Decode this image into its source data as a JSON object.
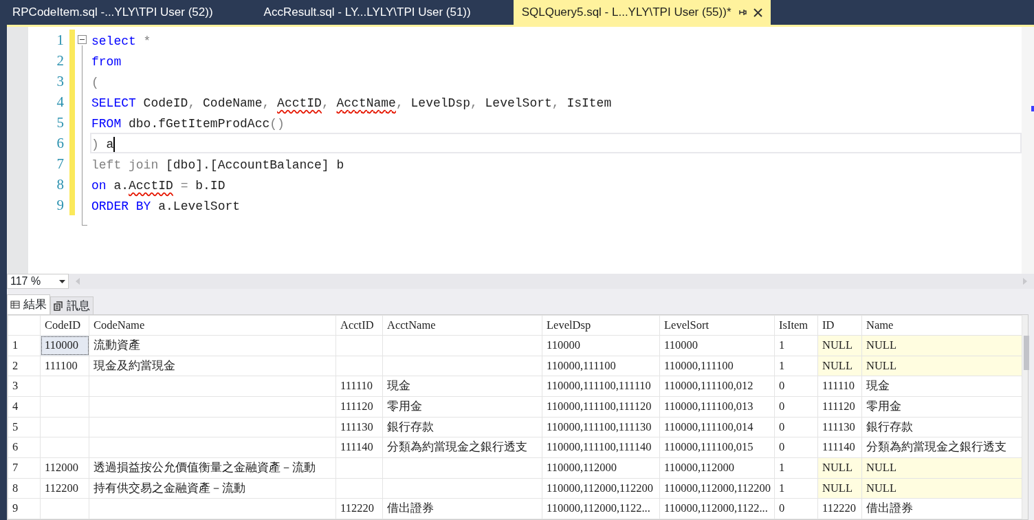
{
  "doc_tabs": [
    {
      "label": "RPCodeItem.sql -...YLY\\TPI User (52))",
      "selected": false
    },
    {
      "label": "AccResult.sql - LY...LYLY\\TPI User (51))",
      "selected": false
    },
    {
      "label": "SQLQuery5.sql - L...YLY\\TPI User (55))*",
      "selected": true
    }
  ],
  "editor": {
    "lines": [
      {
        "number": "1",
        "current": false,
        "tokens": [
          {
            "text": "select",
            "kind": "keyword"
          },
          {
            "text": " *",
            "kind": "operator"
          }
        ]
      },
      {
        "number": "2",
        "current": false,
        "tokens": [
          {
            "text": "from",
            "kind": "keyword"
          }
        ]
      },
      {
        "number": "3",
        "current": false,
        "tokens": [
          {
            "text": "(",
            "kind": "operator"
          }
        ]
      },
      {
        "number": "4",
        "current": false,
        "tokens": [
          {
            "text": "SELECT",
            "kind": "keyword"
          },
          {
            "text": " CodeID",
            "kind": "plain"
          },
          {
            "text": ",",
            "kind": "operator"
          },
          {
            "text": " CodeName",
            "kind": "plain"
          },
          {
            "text": ", ",
            "kind": "operator"
          },
          {
            "text": "AcctID",
            "kind": "error"
          },
          {
            "text": ", ",
            "kind": "operator"
          },
          {
            "text": "AcctName",
            "kind": "error"
          },
          {
            "text": ",",
            "kind": "operator"
          },
          {
            "text": " LevelDsp",
            "kind": "plain"
          },
          {
            "text": ",",
            "kind": "operator"
          },
          {
            "text": " LevelSort",
            "kind": "plain"
          },
          {
            "text": ",",
            "kind": "operator"
          },
          {
            "text": " IsItem",
            "kind": "plain"
          }
        ]
      },
      {
        "number": "5",
        "current": false,
        "tokens": [
          {
            "text": "FROM",
            "kind": "keyword"
          },
          {
            "text": " dbo.fGetItemProdAcc",
            "kind": "plain"
          },
          {
            "text": "()",
            "kind": "operator"
          }
        ]
      },
      {
        "number": "6",
        "current": true,
        "tokens": [
          {
            "text": ")",
            "kind": "operator"
          },
          {
            "text": " a",
            "kind": "plain"
          }
        ]
      },
      {
        "number": "7",
        "current": false,
        "tokens": [
          {
            "text": "left join",
            "kind": "operator"
          },
          {
            "text": " [dbo].[AccountBalance] b",
            "kind": "plain"
          }
        ]
      },
      {
        "number": "8",
        "current": false,
        "tokens": [
          {
            "text": "on",
            "kind": "keyword"
          },
          {
            "text": " a.",
            "kind": "plain"
          },
          {
            "text": "AcctID",
            "kind": "error"
          },
          {
            "text": " = ",
            "kind": "operator"
          },
          {
            "text": "b.ID",
            "kind": "plain"
          }
        ]
      },
      {
        "number": "9",
        "current": false,
        "tokens": [
          {
            "text": "ORDER BY",
            "kind": "keyword"
          },
          {
            "text": " a.LevelSort",
            "kind": "plain"
          }
        ]
      }
    ]
  },
  "zoom": "117 %",
  "result_tabs": [
    {
      "label": "結果",
      "selected": true,
      "kind": "grid"
    },
    {
      "label": "訊息",
      "selected": false,
      "kind": "messages"
    }
  ],
  "grid": {
    "columns": [
      "CodeID",
      "CodeName",
      "AcctID",
      "AcctName",
      "LevelDsp",
      "LevelSort",
      "IsItem",
      "ID",
      "Name"
    ],
    "rows": [
      {
        "number": "1",
        "focused": true,
        "null_join": true,
        "cells": [
          "110000",
          "流動資產",
          null,
          null,
          "110000",
          "110000",
          "1",
          "NULL",
          "NULL"
        ]
      },
      {
        "number": "2",
        "focused": false,
        "null_join": true,
        "cells": [
          "111100",
          "現金及約當現金",
          null,
          null,
          "110000,111100",
          "110000,111100",
          "1",
          "NULL",
          "NULL"
        ]
      },
      {
        "number": "3",
        "focused": false,
        "null_join": false,
        "cells": [
          null,
          null,
          "111110",
          "現金",
          "110000,111100,111110",
          "110000,111100,012",
          "0",
          "111110",
          "現金"
        ]
      },
      {
        "number": "4",
        "focused": false,
        "null_join": false,
        "cells": [
          null,
          null,
          "111120",
          "零用金",
          "110000,111100,111120",
          "110000,111100,013",
          "0",
          "111120",
          "零用金"
        ]
      },
      {
        "number": "5",
        "focused": false,
        "null_join": false,
        "cells": [
          null,
          null,
          "111130",
          "銀行存款",
          "110000,111100,111130",
          "110000,111100,014",
          "0",
          "111130",
          "銀行存款"
        ]
      },
      {
        "number": "6",
        "focused": false,
        "null_join": false,
        "cells": [
          null,
          null,
          "111140",
          "分類為約當現金之銀行透支",
          "110000,111100,111140",
          "110000,111100,015",
          "0",
          "111140",
          "分類為約當現金之銀行透支"
        ]
      },
      {
        "number": "7",
        "focused": false,
        "null_join": true,
        "cells": [
          "112000",
          "透過損益按公允價值衡量之金融資產－流動",
          null,
          null,
          "110000,112000",
          "110000,112000",
          "1",
          "NULL",
          "NULL"
        ]
      },
      {
        "number": "8",
        "focused": false,
        "null_join": true,
        "cells": [
          "112200",
          "持有供交易之金融資產－流動",
          null,
          null,
          "110000,112000,112200",
          "110000,112000,112200",
          "1",
          "NULL",
          "NULL"
        ]
      },
      {
        "number": "9",
        "focused": false,
        "null_join": false,
        "cells": [
          null,
          null,
          "112220",
          "借出證券",
          "110000,112000,1122...",
          "110000,112000,1122...",
          "0",
          "112220",
          "借出證券"
        ]
      }
    ]
  }
}
